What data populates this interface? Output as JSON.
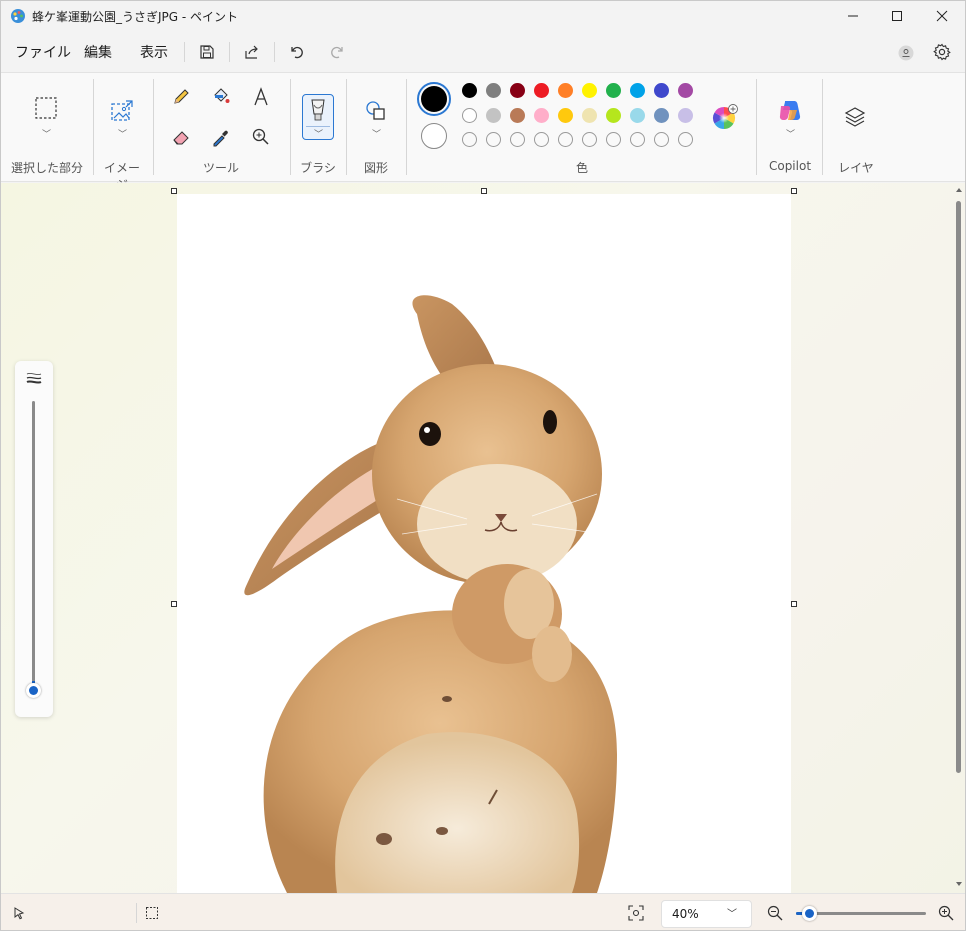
{
  "window": {
    "title": "蜂ケ峯運動公園_うさぎJPG - ペイント",
    "controls": [
      "minimize",
      "maximize",
      "close"
    ]
  },
  "menu": {
    "items": [
      "ファイル",
      "編集",
      "表示"
    ],
    "icons": [
      "save-icon",
      "share-icon",
      "undo-icon",
      "redo-icon",
      "account-icon",
      "settings-icon"
    ]
  },
  "ribbon": {
    "groups": {
      "selection": "選択した部分",
      "image": "イメージ",
      "tools": "ツール",
      "brush": "ブラシ",
      "shapes": "図形",
      "colors": "色",
      "copilot": "Copilot",
      "layers": "レイヤー"
    },
    "tools": [
      "pencil-icon",
      "fill-icon",
      "text-icon",
      "eraser-icon",
      "color-picker-icon",
      "magnifier-icon"
    ],
    "primary_color": "#000000",
    "secondary_color": "#ffffff",
    "palette_row1": [
      "#000000",
      "#7f7f7f",
      "#880015",
      "#ed1c24",
      "#ff7f27",
      "#fff200",
      "#22b14c",
      "#00a2e8",
      "#3f48cc",
      "#a349a4"
    ],
    "palette_row2": [
      "#ffffff",
      "#c3c3c3",
      "#b97a57",
      "#ffaec9",
      "#ffc90e",
      "#efe4b0",
      "#b5e61d",
      "#99d9ea",
      "#7092be",
      "#c8bfe7"
    ],
    "palette_row3_count": 10
  },
  "status": {
    "zoom": "40%",
    "zoom_level": 0.05
  }
}
